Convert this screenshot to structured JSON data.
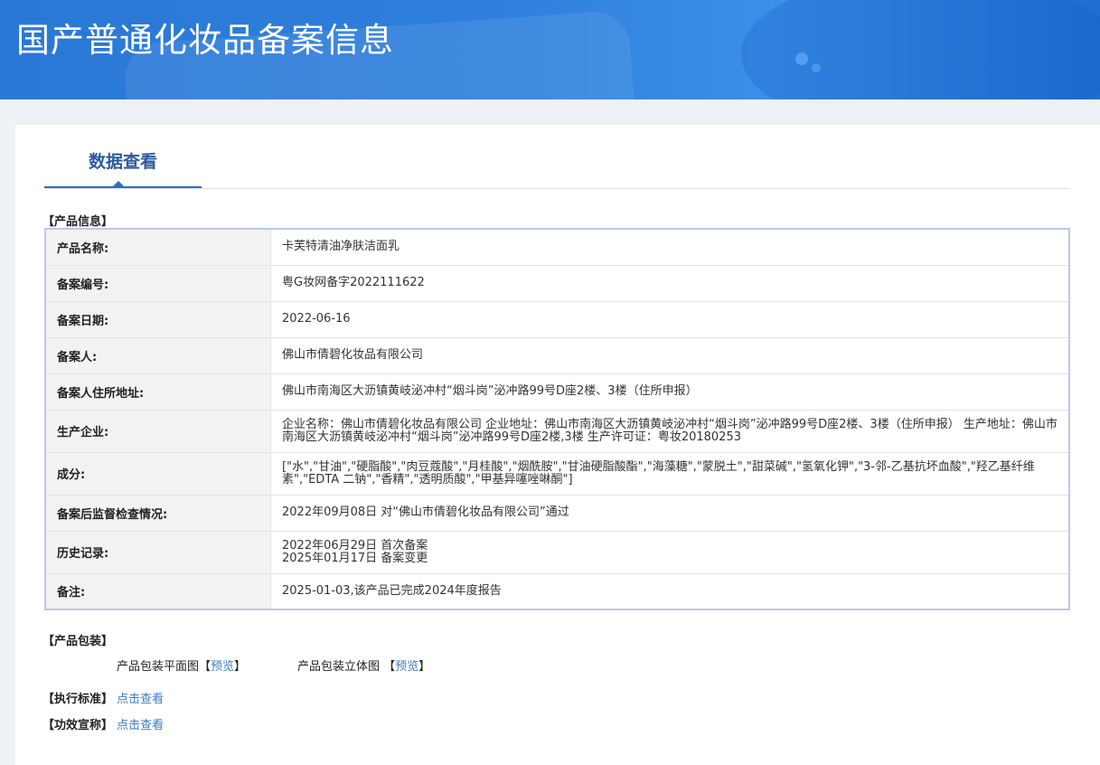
{
  "header": {
    "title": "国产普通化妆品备案信息"
  },
  "tabs": [
    {
      "label": "数据查看"
    }
  ],
  "product_section": {
    "title": "【产品信息】",
    "rows": [
      {
        "key": "产品名称:",
        "value": "卡芙特清油净肤洁面乳"
      },
      {
        "key": "备案编号:",
        "value": "粤G妆网备字2022111622"
      },
      {
        "key": "备案日期:",
        "value": "2022-06-16"
      },
      {
        "key": "备案人:",
        "value": "佛山市倩碧化妆品有限公司"
      },
      {
        "key": "备案人住所地址:",
        "value": "佛山市南海区大沥镇黄岐泌冲村“烟斗岗”泌冲路99号D座2楼、3楼（住所申报）"
      },
      {
        "key": "生产企业:",
        "value": "企业名称：佛山市倩碧化妆品有限公司 企业地址：佛山市南海区大沥镇黄岐泌冲村“烟斗岗”泌冲路99号D座2楼、3楼（住所申报） 生产地址：佛山市南海区大沥镇黄岐泌冲村“烟斗岗”泌冲路99号D座2楼,3楼 生产许可证：粤妆20180253"
      },
      {
        "key": "成分:",
        "value": "[\"水\",\"甘油\",\"硬脂酸\",\"肉豆蔻酸\",\"月桂酸\",\"烟酰胺\",\"甘油硬脂酸酯\",\"海藻糖\",\"蒙脱土\",\"甜菜碱\",\"氢氧化钾\",\"3-邻-乙基抗坏血酸\",\"羟乙基纤维素\",\"EDTA 二钠\",\"香精\",\"透明质酸\",\"甲基异噻唑啉酮\"]"
      },
      {
        "key": "备案后监督检查情况:",
        "value": "2022年09月08日 对“佛山市倩碧化妆品有限公司”通过"
      },
      {
        "key": "历史记录:",
        "value": "2022年06月29日 首次备案",
        "value2": "2025年01月17日 备案变更"
      },
      {
        "key": "备注:",
        "value": "2025-01-03,该产品已完成2024年度报告"
      }
    ]
  },
  "packaging": {
    "title": "【产品包装】",
    "flat_label": "产品包装平面图【",
    "flat_link": "预览",
    "flat_close": "】",
    "solid_label": "产品包装立体图 【",
    "solid_link": "预览",
    "solid_close": "】"
  },
  "standard": {
    "title": "【执行标准】",
    "link": "点击查看"
  },
  "efficacy": {
    "title": "【功效宣称】",
    "link": "点击查看"
  }
}
